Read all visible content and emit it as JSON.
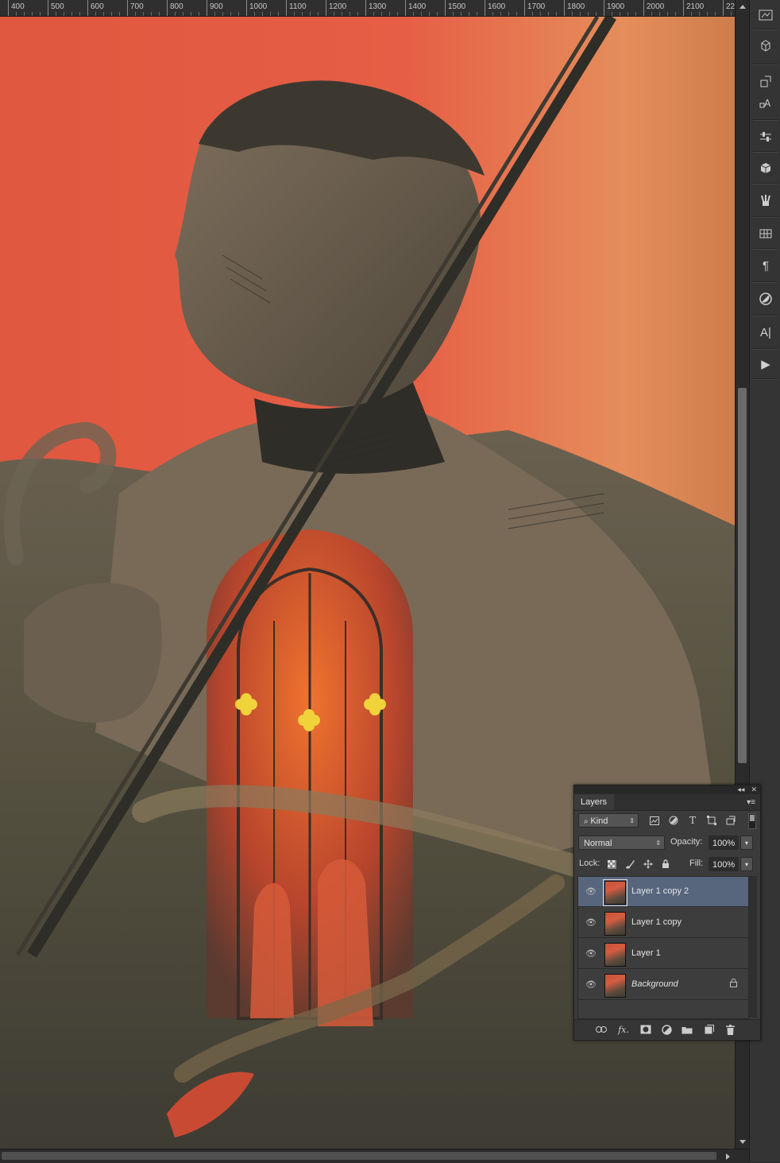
{
  "ruler": {
    "labels": [
      "400",
      "500",
      "600",
      "700",
      "800",
      "900",
      "1000",
      "1100",
      "1200",
      "1300",
      "1400",
      "1500",
      "1600",
      "1700",
      "1800",
      "1900",
      "2000",
      "2100",
      "22"
    ]
  },
  "dock": {
    "icons": [
      "history-icon",
      "3d-icon",
      "clone-source-icon",
      "character-styles-icon",
      "adjustments-icon",
      "cube-icon",
      "brushes-icon",
      "swatches-icon",
      "paragraph-icon",
      "styles-icon",
      "character-icon",
      "actions-icon"
    ],
    "glyphs": {
      "paragraph": "¶",
      "character": "A|",
      "play": "▶"
    }
  },
  "layers_panel": {
    "title": "Layers",
    "collapse_glyph": "◂◂",
    "close_glyph": "✕",
    "filter_kind": "Kind",
    "blend_mode": "Normal",
    "opacity_label": "Opacity:",
    "opacity_value": "100%",
    "lock_label": "Lock:",
    "fill_label": "Fill:",
    "fill_value": "100%",
    "layers": [
      {
        "name": "Layer 1 copy 2",
        "selected": true,
        "visible": true
      },
      {
        "name": "Layer 1 copy",
        "selected": false,
        "visible": true
      },
      {
        "name": "Layer 1",
        "selected": false,
        "visible": true
      },
      {
        "name": "Background",
        "selected": false,
        "visible": true,
        "locked": true
      }
    ],
    "bottom_icons": [
      "link-icon",
      "fx-icon",
      "mask-icon",
      "adjustment-layer-icon",
      "group-folder-icon",
      "new-layer-icon",
      "trash-icon"
    ],
    "fx_label": "fx."
  },
  "colors": {
    "canvas_red": "#e0583f",
    "canvas_dark": "#4d483d",
    "selected_layer": "#57667d"
  }
}
